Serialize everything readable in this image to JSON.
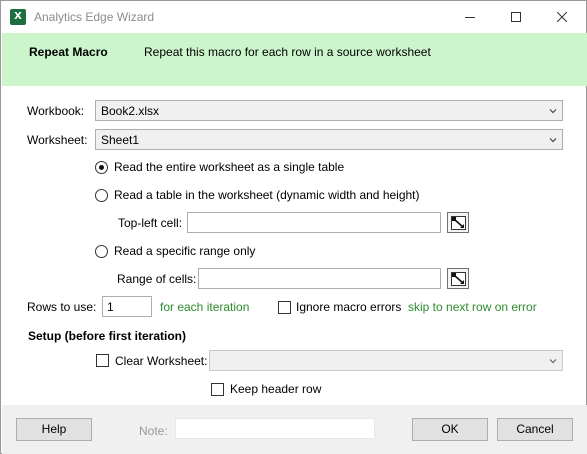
{
  "window": {
    "title": "Analytics Edge Wizard",
    "app_icon": "X"
  },
  "header": {
    "title": "Repeat Macro",
    "description": "Repeat this macro for each row in a source worksheet"
  },
  "form": {
    "workbook_label": "Workbook:",
    "workbook_value": "Book2.xlsx",
    "worksheet_label": "Worksheet:",
    "worksheet_value": "Sheet1",
    "options": [
      {
        "label": "Read the entire worksheet as a single table",
        "selected": true
      },
      {
        "label": "Read a table in the worksheet (dynamic width and height)",
        "selected": false
      },
      {
        "label": "Read a specific range only",
        "selected": false
      }
    ],
    "top_left_label": "Top-left cell:",
    "top_left_value": "",
    "range_label": "Range of cells:",
    "range_value": "",
    "rows_label": "Rows to use:",
    "rows_value": "1",
    "rows_hint": "for each iteration",
    "ignore_errors_label": "Ignore macro errors",
    "ignore_errors_checked": false,
    "ignore_errors_hint": "skip to next row on error"
  },
  "setup": {
    "heading": "Setup (before first iteration)",
    "clear_worksheet_label": "Clear Worksheet:",
    "clear_worksheet_checked": false,
    "clear_worksheet_value": "",
    "keep_header_label": "Keep header row",
    "keep_header_checked": false
  },
  "footer": {
    "help_label": "Help",
    "note_label": "Note:",
    "note_value": "",
    "ok_label": "OK",
    "cancel_label": "Cancel"
  },
  "colors": {
    "header_band": "#ccf5cc",
    "hint_green": "#2e8b2e",
    "footer_bg": "#f0f0f0"
  }
}
